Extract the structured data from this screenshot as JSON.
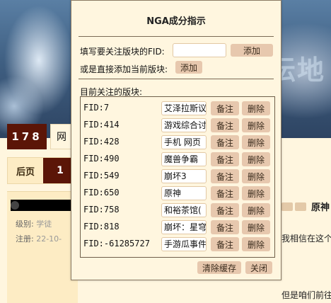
{
  "background": {
    "banner_text": "坛地",
    "logo": "178",
    "nav_tab": "网",
    "pager": {
      "back": "后页",
      "current": "1"
    },
    "user": {
      "level_label": "级别:",
      "level_value": "学徒",
      "reg_label": "注册:",
      "reg_value": "22-10-"
    },
    "post": {
      "title": "原神",
      "line1": "我相信在这个",
      "line2": "但是咱们前往"
    }
  },
  "dialog": {
    "title": "NGA成分指示",
    "fid_prompt": "填写要关注版块的FID:",
    "fid_input_value": "",
    "add_button": "添加",
    "current_prompt": "或是直接添加当前版块:",
    "add_current_button": "添加",
    "list_title": "目前关注的版块:",
    "remark_button": "备注",
    "delete_button": "删除",
    "forums": [
      {
        "fid": "FID:7",
        "remark": "艾泽拉斯议"
      },
      {
        "fid": "FID:414",
        "remark": "游戏综合讨"
      },
      {
        "fid": "FID:428",
        "remark": "手机 网页"
      },
      {
        "fid": "FID:490",
        "remark": "魔兽争霸"
      },
      {
        "fid": "FID:549",
        "remark": "崩坏3"
      },
      {
        "fid": "FID:650",
        "remark": "原神"
      },
      {
        "fid": "FID:758",
        "remark": "和裕茶馆("
      },
      {
        "fid": "FID:818",
        "remark": "崩坏：星穹"
      },
      {
        "fid": "FID:-61285727",
        "remark": "手游瓜事件"
      }
    ],
    "clear_cache_button": "清除缓存",
    "close_button": "关闭"
  },
  "colors": {
    "page_bg": "#fff6df",
    "button_bg": "#e7c8ae",
    "logo_bg": "#5b1507",
    "dialog_border": "#8a7a63"
  }
}
